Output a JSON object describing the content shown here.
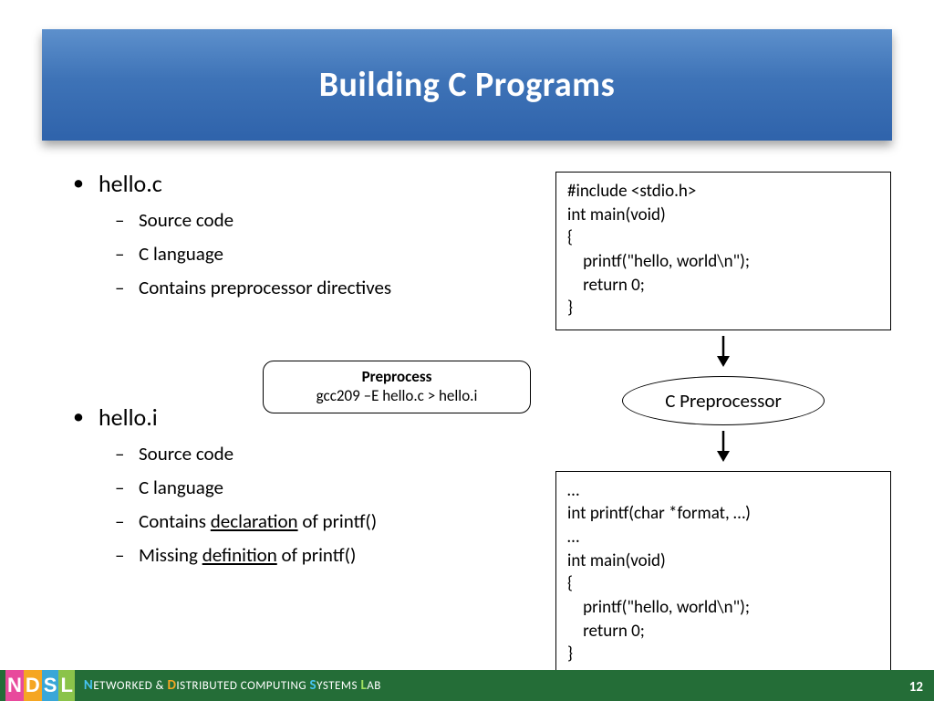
{
  "title": "Building C Programs",
  "bullets": {
    "first": {
      "head": "hello.c",
      "items": [
        "Source code",
        "C language",
        "Contains preprocessor directives"
      ]
    },
    "second": {
      "head": "hello.i",
      "items": {
        "a": "Source code",
        "b": "C language",
        "c_pre": "Contains ",
        "c_u": "declaration",
        "c_post": " of printf()",
        "d_pre": "Missing ",
        "d_u": "definition",
        "d_post": " of printf()"
      }
    }
  },
  "preprocess": {
    "title": "Preprocess",
    "command": "gcc209 –E hello.c > hello.i"
  },
  "flow": {
    "code_top": "#include <stdio.h>\nint main(void)\n{\n    printf(\"hello, world\\n\");\n    return 0;\n}",
    "ellipse": "C Preprocessor",
    "code_bottom": "…\nint printf(char *format, …)\n…\nint main(void)\n{\n    printf(\"hello, world\\n\");\n    return 0;\n}"
  },
  "footer": {
    "text": {
      "n": "N",
      "net": "ETWORKED & ",
      "d": "D",
      "dist": "ISTRIBUTED COMPUTING ",
      "s": "S",
      "sys": "YSTEMS ",
      "l": "L",
      "lab": "AB"
    },
    "logo": {
      "a": "N",
      "b": "D",
      "c": "S",
      "d": "L"
    },
    "page": "12"
  }
}
